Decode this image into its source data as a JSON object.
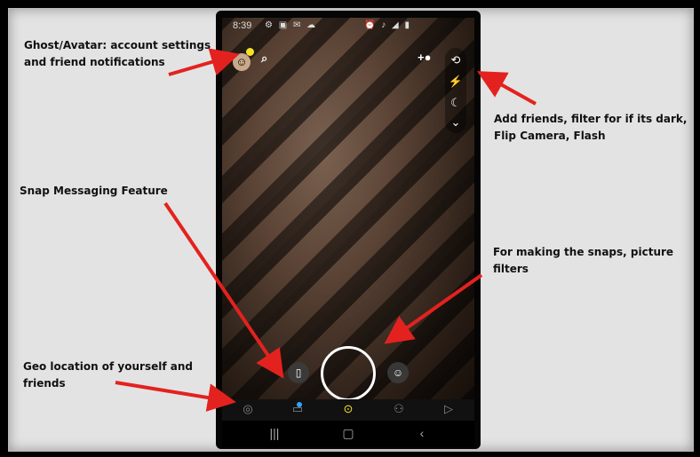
{
  "annotations": {
    "ghost": {
      "line1": "Ghost/Avatar: account settings",
      "line2": "and friend notifications"
    },
    "add_friends": {
      "line1": "Add friends,  filter for if its dark,",
      "line2": "Flip Camera, Flash"
    },
    "snap_messaging": "Snap Messaging Feature",
    "snaps": {
      "line1": "For making the snaps, picture",
      "line2": "filters"
    },
    "geo": {
      "line1": "Geo location of yourself and",
      "line2": "friends"
    }
  },
  "phone": {
    "status_bar": {
      "time": "8:39"
    },
    "icons": {
      "avatar": "avatar-icon",
      "search": "search-icon",
      "add_friend": "add-friend-icon",
      "flip_camera": "flip-camera-icon",
      "flash": "flash-off-icon",
      "night_mode": "moon-icon",
      "more": "chevron-down-icon",
      "memories": "memories-icon",
      "lenses": "smiley-icon",
      "map": "map-pin-icon",
      "chat": "chat-icon",
      "camera": "camera-icon",
      "stories": "friends-icon",
      "spotlight": "play-icon"
    },
    "colors": {
      "accent": "#f5e12a",
      "notification": "#2fa4ff"
    }
  },
  "colors": {
    "arrow": "#e3221f"
  }
}
